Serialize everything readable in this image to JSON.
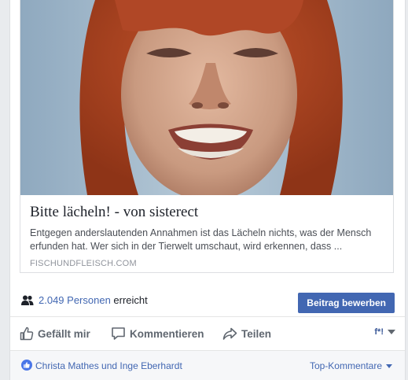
{
  "link_preview": {
    "title": "Bitte lächeln! - von sisterect",
    "description": "Entgegen anderslautenden Annahmen ist das Lächeln nichts, was der Mensch erfunden hat. Wer sich in der Tierwelt umschaut, wird erkennen, dass ...",
    "domain": "FISCHUNDFLEISCH.COM"
  },
  "reach": {
    "count_link": "2.049 Personen",
    "suffix": "erreicht",
    "boost_label": "Beitrag bewerben"
  },
  "actions": {
    "like": "Gefällt mir",
    "comment": "Kommentieren",
    "share": "Teilen",
    "reaction_label": "f*!"
  },
  "footer": {
    "likers": "Christa Mathes und Inge Eberhardt",
    "sort_label": "Top-Kommentare"
  },
  "colors": {
    "brand": "#4267b2",
    "background": "#e9ebee",
    "text": "#1d2129",
    "muted": "#606770"
  }
}
